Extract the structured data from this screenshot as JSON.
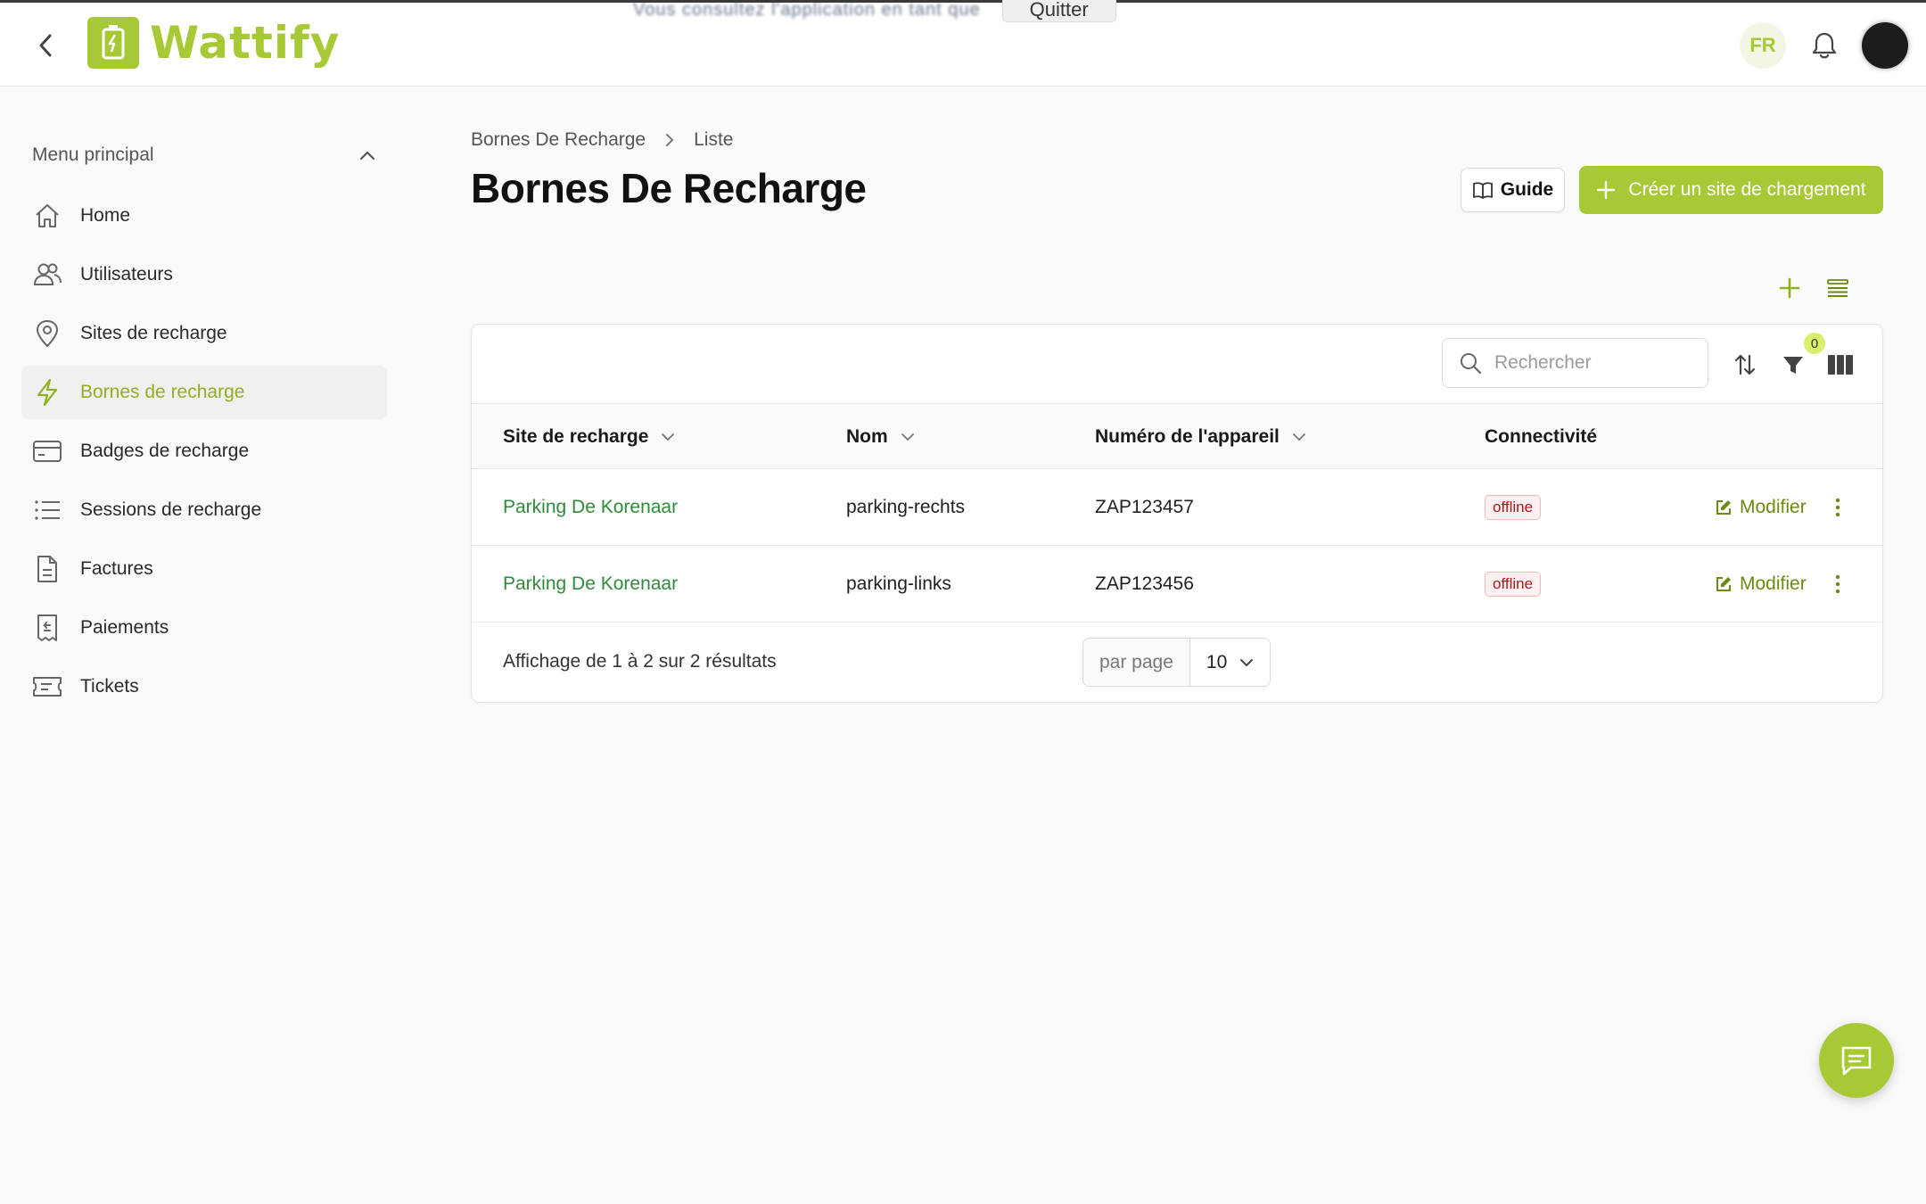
{
  "banner": {
    "text": "Vous consultez l'application en tant que",
    "quit_label": "Quitter"
  },
  "app": {
    "name": "Wattify"
  },
  "header": {
    "language": "FR"
  },
  "sidebar": {
    "title": "Menu principal",
    "items": [
      {
        "label": "Home",
        "icon": "home-icon",
        "active": false
      },
      {
        "label": "Utilisateurs",
        "icon": "users-icon",
        "active": false
      },
      {
        "label": "Sites de recharge",
        "icon": "map-pin-icon",
        "active": false
      },
      {
        "label": "Bornes de recharge",
        "icon": "lightning-icon",
        "active": true
      },
      {
        "label": "Badges de recharge",
        "icon": "credit-card-icon",
        "active": false
      },
      {
        "label": "Sessions de recharge",
        "icon": "list-icon",
        "active": false
      },
      {
        "label": "Factures",
        "icon": "document-icon",
        "active": false
      },
      {
        "label": "Paiements",
        "icon": "receipt-icon",
        "active": false
      },
      {
        "label": "Tickets",
        "icon": "ticket-icon",
        "active": false
      }
    ]
  },
  "breadcrumb": [
    "Bornes De Recharge",
    "Liste"
  ],
  "page": {
    "title": "Bornes De Recharge",
    "guide_label": "Guide",
    "create_label": "Créer un site de chargement"
  },
  "table": {
    "search_placeholder": "Rechercher",
    "filter_count": "0",
    "columns": [
      "Site de recharge",
      "Nom",
      "Numéro de l'appareil",
      "Connectivité"
    ],
    "rows": [
      {
        "site": "Parking De Korenaar",
        "name": "parking-rechts",
        "device": "ZAP123457",
        "status": "offline",
        "action": "Modifier"
      },
      {
        "site": "Parking De Korenaar",
        "name": "parking-links",
        "device": "ZAP123456",
        "status": "offline",
        "action": "Modifier"
      }
    ],
    "results_text": "Affichage de 1 à 2 sur 2 résultats",
    "per_page_label": "par page",
    "per_page_value": "10"
  },
  "colors": {
    "brand": "#a8c936",
    "link": "#2f8a3a",
    "status_offline": "#b01616"
  }
}
